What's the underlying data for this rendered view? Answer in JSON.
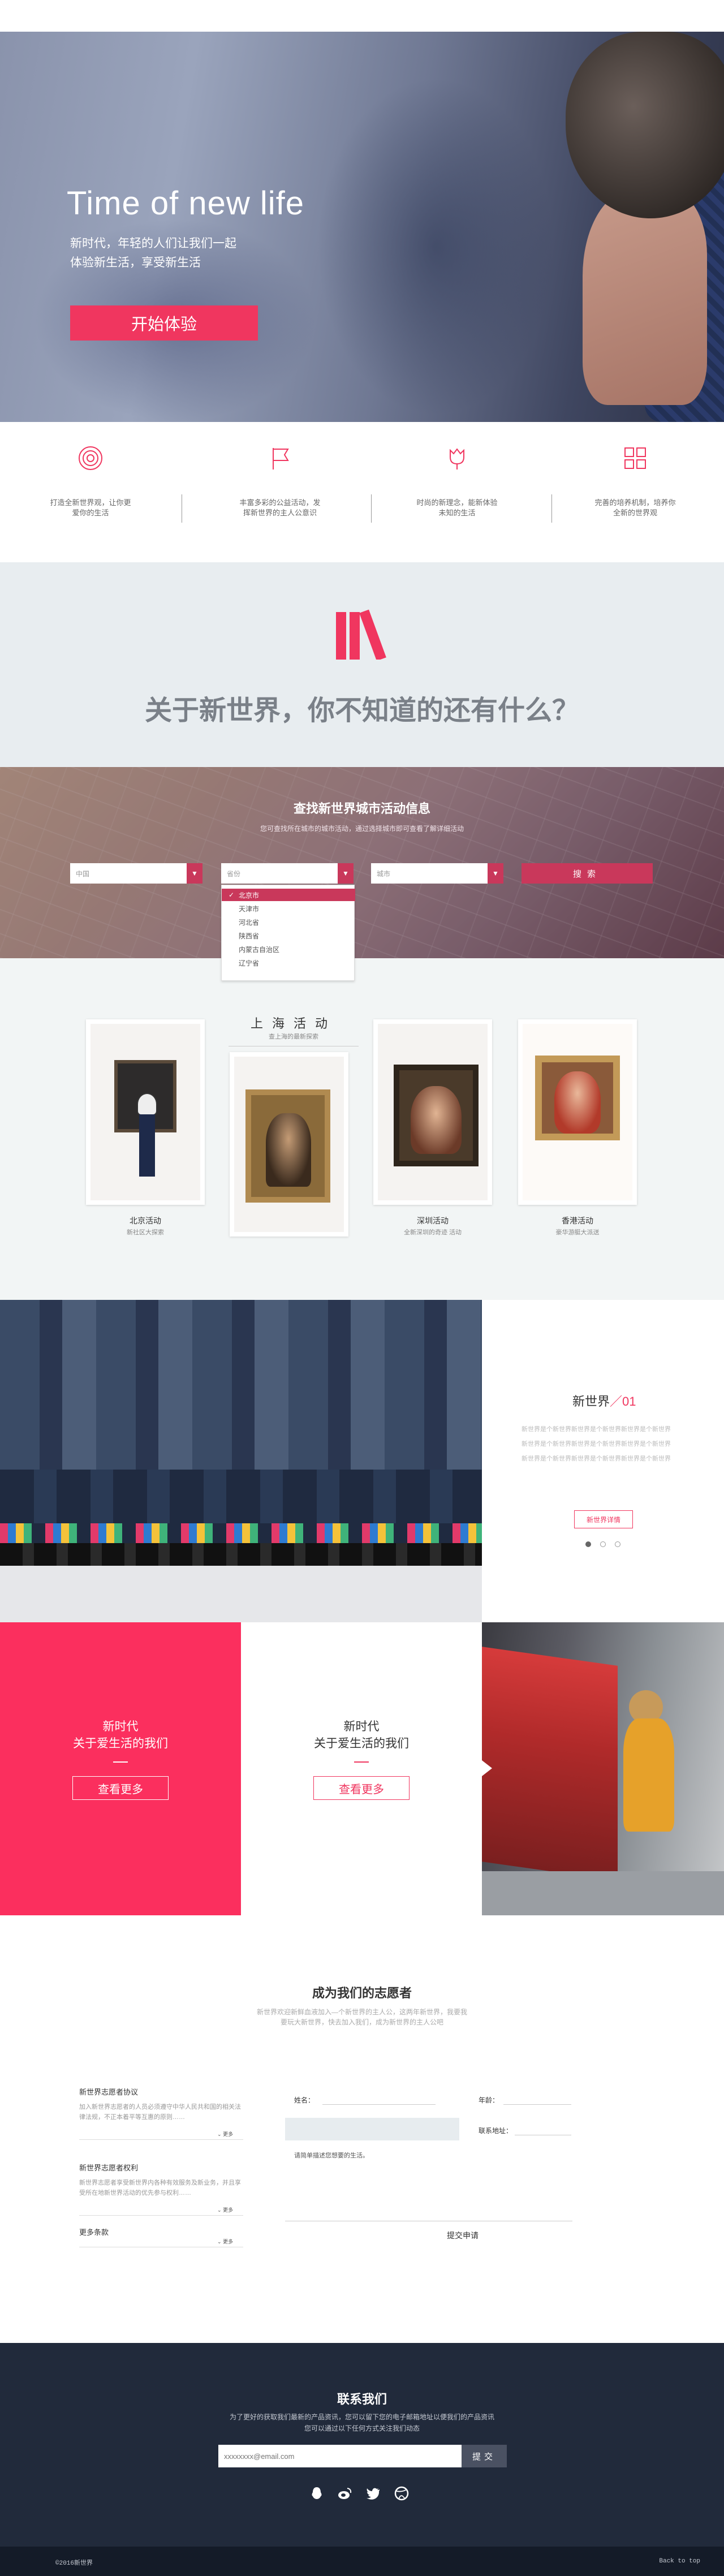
{
  "hero": {
    "title": "Time of new life",
    "subtitle_line1": "新时代，年轻的人们让我们一起",
    "subtitle_line2": "体验新生活，享受新生活",
    "cta_label": "开始体验"
  },
  "features": [
    {
      "icon": "target-icon",
      "line1": "打造全新世界观，让你更",
      "line2": "爱你的生活"
    },
    {
      "icon": "flag-icon",
      "line1": "丰富多彩的公益活动，发",
      "line2": "挥新世界的主人公意识"
    },
    {
      "icon": "tulip-icon",
      "line1": "时尚的新理念，能新体验",
      "line2": "未知的生活"
    },
    {
      "icon": "grid-icon",
      "line1": "完善的培养机制，培养你",
      "line2": "全新的世界观"
    }
  ],
  "question": {
    "icon": "books-icon",
    "title": "关于新世界，你不知道的还有什么？"
  },
  "search": {
    "title": "查找新世界城市活动信息",
    "subtitle": "您可查找所在城市的城市活动，通过选择城市即可查看了解详细活动",
    "country_value": "中国",
    "province_value": "省份",
    "city_value": "城市",
    "button_label": "搜索",
    "province_options": [
      "北京市",
      "天津市",
      "河北省",
      "陕西省",
      "内蒙古自治区",
      "辽宁省"
    ],
    "selected_option": "北京市"
  },
  "gallery": {
    "shanghai_title": "上海活动",
    "shanghai_subtitle": "查上海的最新探索",
    "cards": [
      {
        "title": "北京活动",
        "subtitle": "新社区大探索"
      },
      {
        "title": "深圳活动",
        "subtitle": "全新深圳的奇迹 活动"
      },
      {
        "title": "香港活动",
        "subtitle": "豪华游艇大派送"
      }
    ]
  },
  "new_world": {
    "title_prefix": "新世界",
    "title_suffix": "／01",
    "lines": [
      "新世界是个新世界新世界是个新世界新世界是个新世界",
      "新世界是个新世界新世界是个新世界新世界是个新世界",
      "新世界是个新世界新世界是个新世界新世界是个新世界"
    ],
    "button_label": "新世界详情"
  },
  "cta": [
    {
      "line1": "新时代",
      "line2": "关于爱生活的我们",
      "button": "查看更多"
    },
    {
      "line1": "新时代",
      "line2": "关于爱生活的我们",
      "button": "查看更多"
    }
  ],
  "volunteer": {
    "title": "成为我们的志愿者",
    "subtitle_line1": "新世界欢迎新鲜血液加入—个新世界的主人公，这两年新世界，我要我",
    "subtitle_line2": "要玩大新世界，快去加入我们，成为新世界的主人公吧",
    "sections": [
      {
        "title": "新世界志愿者协议",
        "text": "加入新世界志愿者的人员必须遵守中华人民共和国的相关法律法规，不正本着平等互惠的原则……",
        "more": "更多"
      },
      {
        "title": "新世界志愿者权利",
        "text": "新世界志愿者享受新世界内各种有效服务及新业务，并且享受所在地新世界活动的优先参与权利……",
        "more": "更多"
      },
      {
        "title": "更多条款",
        "text": "",
        "more": "更多"
      }
    ],
    "form": {
      "name_label": "姓名：",
      "age_label": "年龄：",
      "contact_label": "联系地址：",
      "message_placeholder": "请简单描述您想要的生活。",
      "submit_label": "提交申请"
    }
  },
  "contact": {
    "title": "联系我们",
    "subtitle_line1": "为了更好的获取我们最新的产品资讯，您可以留下您的电子邮箱地址以便我们的产品资讯",
    "subtitle_line2": "您可以通过以下任何方式关注我们动态",
    "email_placeholder": "xxxxxxxx@email.com",
    "submit_label": "提交",
    "social": [
      "qq-icon",
      "weibo-icon",
      "twitter-icon",
      "dribbble-icon"
    ]
  },
  "footer": {
    "copyright": "©2016新世界",
    "back_to_top": "Back to top"
  },
  "colors": {
    "accent": "#f0365f",
    "accent_dark": "#c9385b",
    "band_grey": "#e8edf0",
    "footer_dark": "#212a3b"
  }
}
